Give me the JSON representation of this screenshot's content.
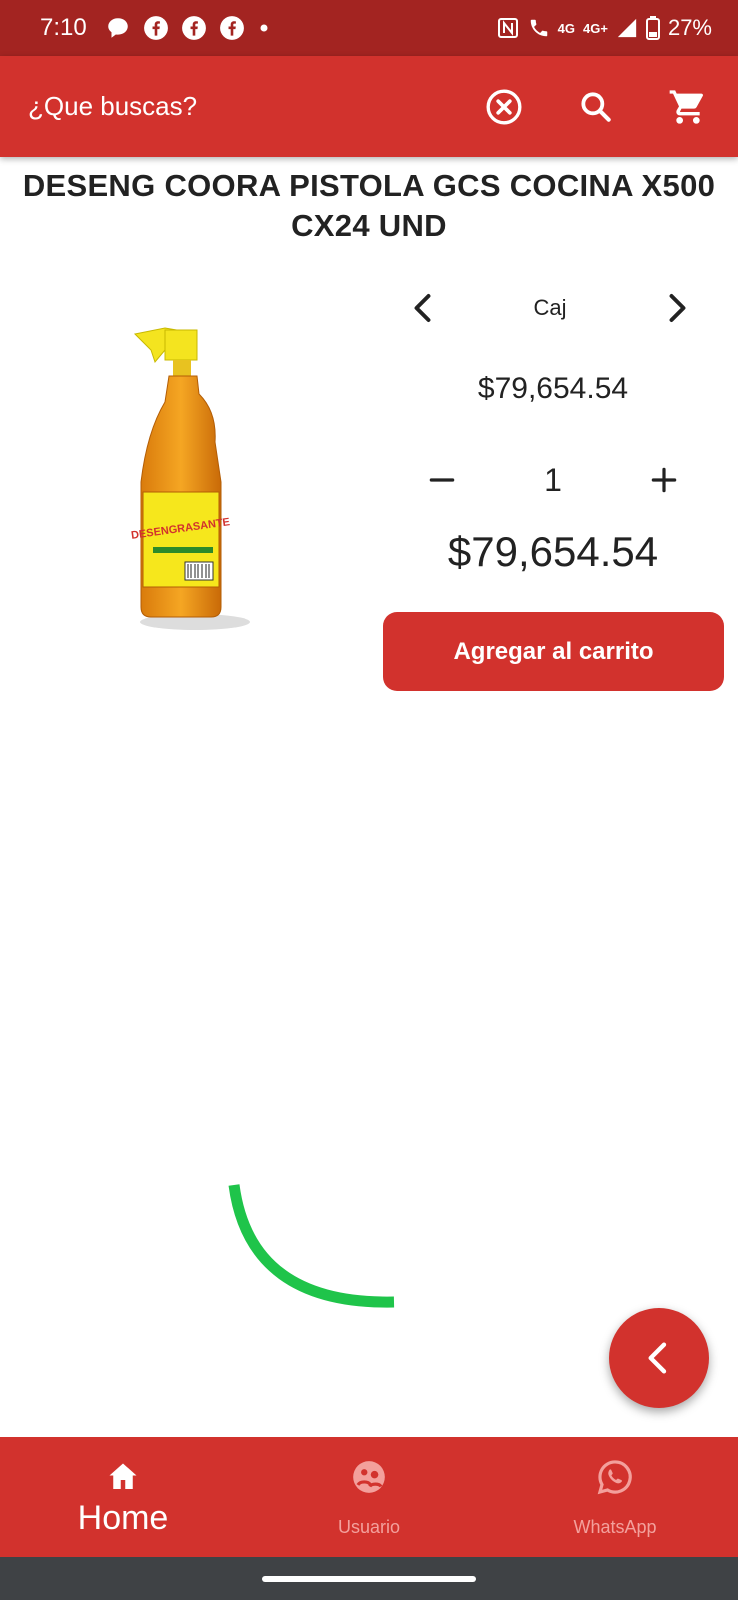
{
  "status_bar": {
    "time": "7:10",
    "network_small": "4G",
    "network": "4G+",
    "battery": "27%"
  },
  "app_bar": {
    "search_label": "¿Que buscas?",
    "icons": [
      "clear-icon",
      "search-icon",
      "cart-icon"
    ]
  },
  "product": {
    "title": "DESENG COORA PISTOLA GCS COCINA X500 CX24 UND",
    "unit": "Caj",
    "unit_price": "$79,654.54",
    "quantity": "1",
    "total_price": "$79,654.54",
    "add_to_cart_label": "Agregar al carrito",
    "image_label_brand": "DESENGRASANTE"
  },
  "bottom_nav": {
    "items": [
      {
        "label": "Home",
        "icon": "home-icon",
        "active": true
      },
      {
        "label": "Usuario",
        "icon": "user-icon",
        "active": false
      },
      {
        "label": "WhatsApp",
        "icon": "whatsapp-icon",
        "active": false
      }
    ]
  },
  "colors": {
    "primary": "#d2322d",
    "status_bar": "#a32421",
    "spinner": "#1fc44a"
  }
}
